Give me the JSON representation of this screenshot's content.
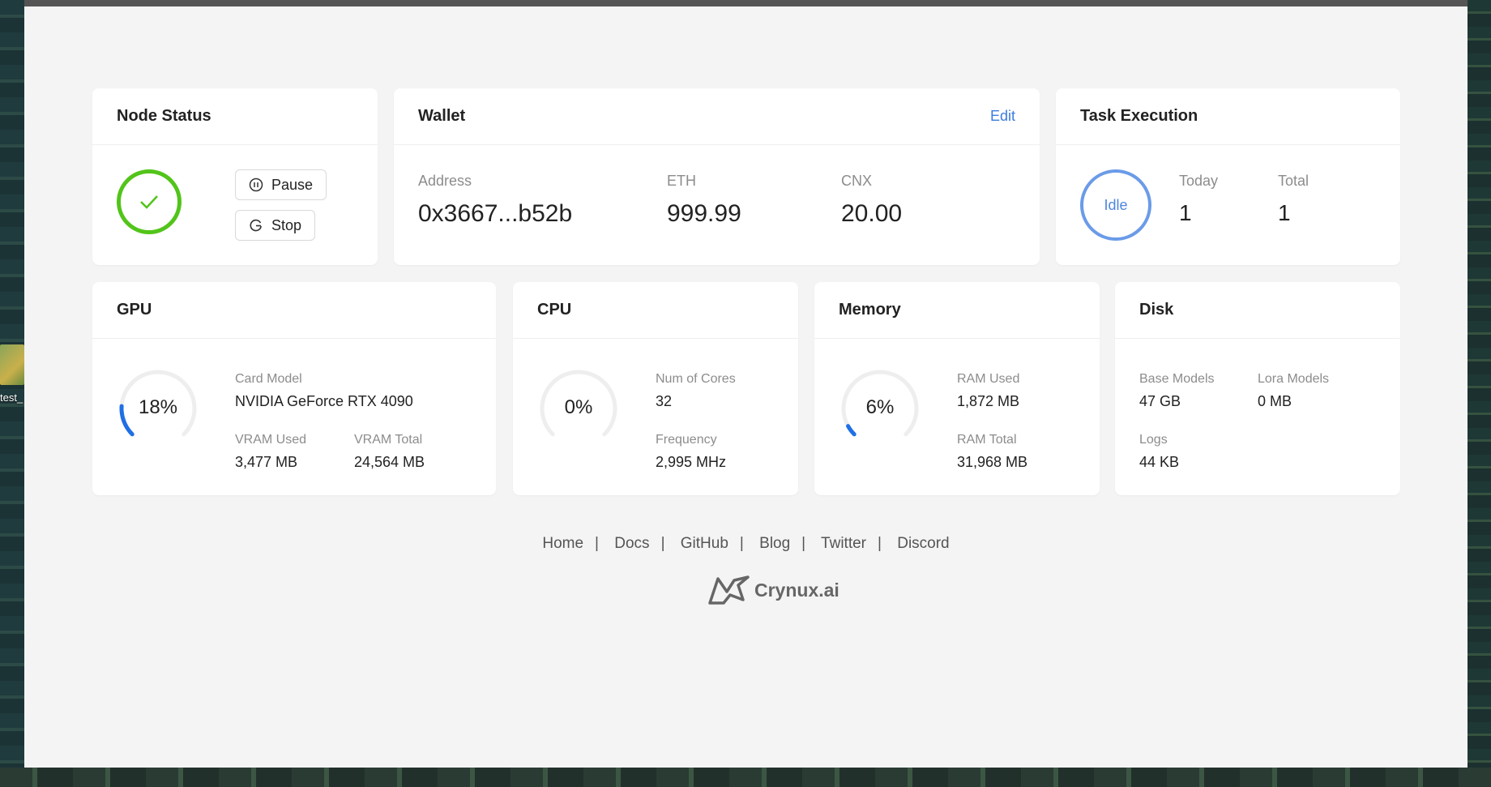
{
  "desktop": {
    "icon_label": "test_"
  },
  "node_status": {
    "title": "Node Status",
    "pause_label": "Pause",
    "stop_label": "Stop",
    "state_color": "#52c41a"
  },
  "wallet": {
    "title": "Wallet",
    "edit_label": "Edit",
    "address_label": "Address",
    "address_value": "0x3667...b52b",
    "eth_label": "ETH",
    "eth_value": "999.99",
    "cnx_label": "CNX",
    "cnx_value": "20.00"
  },
  "task_execution": {
    "title": "Task Execution",
    "state": "Idle",
    "today_label": "Today",
    "today_value": "1",
    "total_label": "Total",
    "total_value": "1"
  },
  "gpu": {
    "title": "GPU",
    "usage_text": "18%",
    "usage": 0.18,
    "card_model_label": "Card Model",
    "card_model_value": "NVIDIA GeForce RTX 4090",
    "vram_used_label": "VRAM Used",
    "vram_used_value": "3,477 MB",
    "vram_total_label": "VRAM Total",
    "vram_total_value": "24,564 MB"
  },
  "cpu": {
    "title": "CPU",
    "usage_text": "0%",
    "usage": 0,
    "cores_label": "Num of Cores",
    "cores_value": "32",
    "freq_label": "Frequency",
    "freq_value": "2,995 MHz"
  },
  "memory": {
    "title": "Memory",
    "usage_text": "6%",
    "usage": 0.06,
    "ram_used_label": "RAM Used",
    "ram_used_value": "1,872 MB",
    "ram_total_label": "RAM Total",
    "ram_total_value": "31,968 MB"
  },
  "disk": {
    "title": "Disk",
    "base_label": "Base Models",
    "base_value": "47 GB",
    "lora_label": "Lora Models",
    "lora_value": "0 MB",
    "logs_label": "Logs",
    "logs_value": "44 KB"
  },
  "footer": {
    "links": [
      "Home",
      "Docs",
      "GitHub",
      "Blog",
      "Twitter",
      "Discord"
    ],
    "brand": "Crynux.ai"
  },
  "colors": {
    "accent": "#3b7ce0",
    "gauge": "#1f6fe5",
    "idle": "#6b9be8",
    "ok": "#52c41a"
  }
}
